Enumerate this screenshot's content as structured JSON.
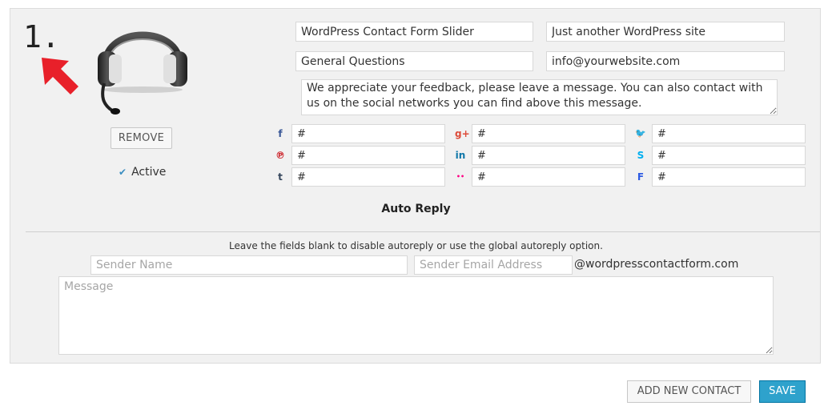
{
  "step_number": "1.",
  "contact": {
    "form_title": "WordPress Contact Form Slider",
    "site_tagline": "Just another WordPress site",
    "subject": "General Questions",
    "email": "info@yourwebsite.com",
    "message": "We appreciate your feedback, please leave a message. You can also contact with us on the social networks you can find above this message.",
    "remove_label": "REMOVE",
    "active_label": "Active"
  },
  "social": [
    {
      "icon": "facebook-icon",
      "glyph": "f",
      "color": "#3b5998",
      "value": "#"
    },
    {
      "icon": "google-plus-icon",
      "glyph": "g+",
      "color": "#dd4b39",
      "value": "#"
    },
    {
      "icon": "twitter-icon",
      "glyph": "🐦",
      "color": "#1da1f2",
      "value": "#"
    },
    {
      "icon": "pinterest-icon",
      "glyph": "℗",
      "color": "#cb2027",
      "value": "#"
    },
    {
      "icon": "linkedin-icon",
      "glyph": "in",
      "color": "#0e76a8",
      "value": "#"
    },
    {
      "icon": "skype-icon",
      "glyph": "S",
      "color": "#00aff0",
      "value": "#"
    },
    {
      "icon": "tumblr-icon",
      "glyph": "t",
      "color": "#35465c",
      "value": "#"
    },
    {
      "icon": "flickr-icon",
      "glyph": "••",
      "color": "#ff0084",
      "value": "#"
    },
    {
      "icon": "foursquare-icon",
      "glyph": "F",
      "color": "#2d5be3",
      "value": "#"
    }
  ],
  "auto_reply": {
    "title": "Auto Reply",
    "hint": "Leave the fields blank to disable autoreply or use the global autoreply option.",
    "sender_name_placeholder": "Sender Name",
    "sender_email_placeholder": "Sender Email Address",
    "domain": "@wordpresscontactform.com",
    "message_placeholder": "Message"
  },
  "actions": {
    "add_label": "ADD NEW CONTACT",
    "save_label": "SAVE"
  },
  "colors": {
    "accent": "#2ea2cc",
    "arrow": "#e8202a",
    "panel_bg": "#f1f1f1"
  }
}
